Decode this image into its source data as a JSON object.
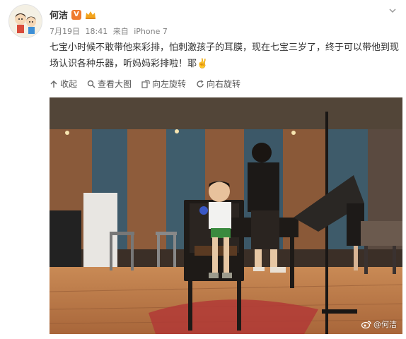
{
  "post": {
    "author": "何洁",
    "verified_badge": "V",
    "date": "7月19日",
    "time": "18:41",
    "source_prefix": "来自",
    "source": "iPhone 7",
    "content": "七宝小时候不敢带他来彩排，怕刺激孩子的耳膜，现在七宝三岁了，终于可以带他到现场认识各种乐器，听妈妈彩排啦！耶✌️",
    "accent_color": "#ef7a2f"
  },
  "toolbar": {
    "collapse": "收起",
    "view_large": "查看大图",
    "rotate_left": "向左旋转",
    "rotate_right": "向右旋转"
  },
  "photo": {
    "watermark": "@何洁"
  }
}
